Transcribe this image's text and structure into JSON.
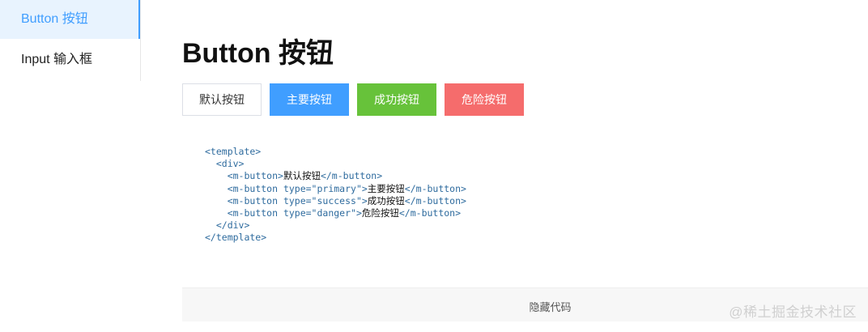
{
  "sidebar": {
    "items": [
      {
        "label": "Button 按钮",
        "active": true
      },
      {
        "label": "Input 输入框",
        "active": false
      }
    ]
  },
  "main": {
    "title": "Button 按钮",
    "buttons": [
      {
        "label": "默认按钮",
        "type": "default"
      },
      {
        "label": "主要按钮",
        "type": "primary"
      },
      {
        "label": "成功按钮",
        "type": "success"
      },
      {
        "label": "危险按钮",
        "type": "danger"
      }
    ],
    "code": {
      "template_open": "<template>",
      "div_open": "<div>",
      "lines": [
        {
          "open": "<m-button>",
          "text": "默认按钮",
          "close": "</m-button>"
        },
        {
          "open": "<m-button type=\"primary\">",
          "text": "主要按钮",
          "close": "</m-button>"
        },
        {
          "open": "<m-button type=\"success\">",
          "text": "成功按钮",
          "close": "</m-button>"
        },
        {
          "open": "<m-button type=\"danger\">",
          "text": "危险按钮",
          "close": "</m-button>"
        }
      ],
      "div_close": "</div>",
      "template_close": "</template>"
    },
    "toggle_label": "隐藏代码"
  },
  "watermark": "@稀土掘金技术社区",
  "colors": {
    "primary": "#409eff",
    "success": "#67c23a",
    "danger": "#f56c6c",
    "default_border": "#dcdfe6"
  }
}
